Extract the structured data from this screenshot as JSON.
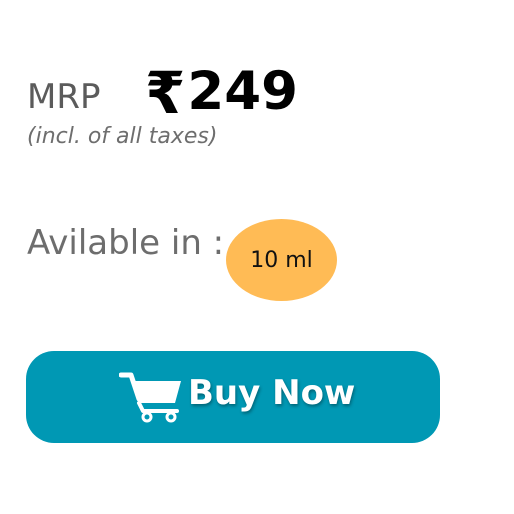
{
  "product": {
    "mrp_label": "MRP",
    "currency_symbol": "₹",
    "price": "249",
    "tax_note": "(incl. of all taxes)"
  },
  "availability": {
    "label": "Avilable in :",
    "sizes": [
      "10 ml"
    ]
  },
  "cta": {
    "label": "Buy Now",
    "icon": "shopping-cart-icon"
  },
  "colors": {
    "button": "#0098b4",
    "size_chip": "#ffbb55",
    "price_text": "#000000",
    "muted_text": "#6d6d6d"
  }
}
